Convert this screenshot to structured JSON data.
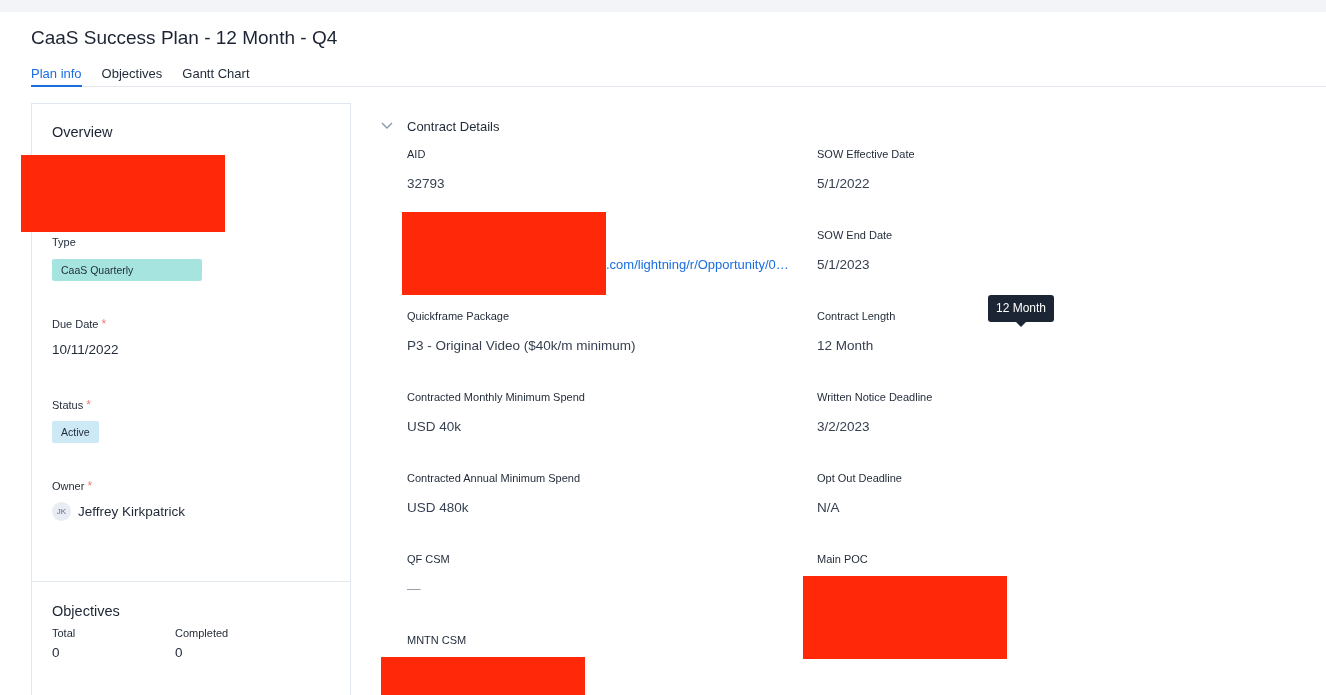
{
  "title": "CaaS Success Plan - 12 Month - Q4",
  "tabs": [
    {
      "label": "Plan info",
      "selected": true
    },
    {
      "label": "Objectives",
      "selected": false
    },
    {
      "label": "Gantt Chart",
      "selected": false
    }
  ],
  "overview": {
    "heading": "Overview",
    "fields": [
      {
        "kind": "redacted"
      },
      {
        "kind": "tag",
        "label": "Type",
        "value": "CaaS Quarterly",
        "color": "#a6e4e0"
      },
      {
        "kind": "text",
        "label": "Due Date",
        "required_mark": "*",
        "value": "10/11/2022"
      },
      {
        "kind": "tag",
        "label": "Status",
        "required_mark": "*",
        "value": "Active",
        "color": "#cde9f6"
      },
      {
        "kind": "person",
        "label": "Owner",
        "required_mark": "*",
        "initials": "JK",
        "value": "Jeffrey Kirkpatrick"
      }
    ]
  },
  "objectives": {
    "heading": "Objectives",
    "stats": [
      {
        "label": "Total",
        "value": "0"
      },
      {
        "label": "Completed",
        "value": "0"
      }
    ]
  },
  "contract": {
    "heading": "Contract Details",
    "expanded": true,
    "fields": [
      {
        "kind": "text",
        "label": "AID",
        "value": "32793"
      },
      {
        "kind": "text",
        "label": "SOW Effective Date",
        "value": "5/1/2022"
      },
      {
        "kind": "redacted-link",
        "value": ".com/lightning/r/Opportunity/0…"
      },
      {
        "kind": "text",
        "label": "SOW End Date",
        "value": "5/1/2023"
      },
      {
        "kind": "text",
        "label": "Quickframe Package",
        "value": "P3 - Original Video ($40k/m minimum)"
      },
      {
        "kind": "text",
        "label": "Contract Length",
        "value": "12 Month",
        "tooltip": "12 Month"
      },
      {
        "kind": "text",
        "label": "Contracted Monthly Minimum Spend",
        "value": "USD 40k"
      },
      {
        "kind": "text",
        "label": "Written Notice Deadline",
        "value": "3/2/2023"
      },
      {
        "kind": "text",
        "label": "Contracted Annual Minimum Spend",
        "value": "USD 480k"
      },
      {
        "kind": "text",
        "label": "Opt Out Deadline",
        "value": "N/A"
      },
      {
        "kind": "empty",
        "label": "QF CSM",
        "value": "—"
      },
      {
        "kind": "redacted-value",
        "label": "Main POC"
      },
      {
        "kind": "redacted-value",
        "label": "MNTN CSM"
      }
    ]
  }
}
